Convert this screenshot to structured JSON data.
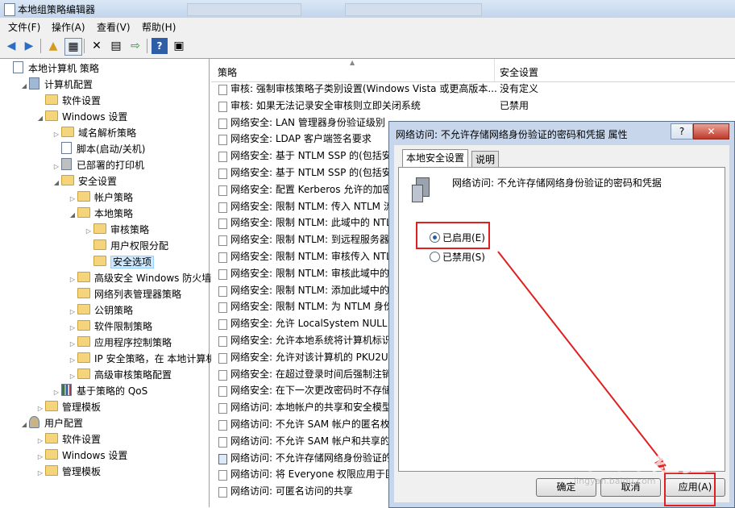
{
  "window": {
    "title": "本地组策略编辑器"
  },
  "menu": [
    "文件(F)",
    "操作(A)",
    "查看(V)",
    "帮助(H)"
  ],
  "toolbar_icons": [
    "back-icon",
    "forward-icon",
    "up-icon",
    "show-hide-tree-icon",
    "delete-icon",
    "properties-icon",
    "export-icon",
    "help-icon",
    "view-icon"
  ],
  "tree": [
    {
      "label": "本地计算机 策略",
      "level": 0,
      "icon": "doc",
      "arrow": ""
    },
    {
      "label": "计算机配置",
      "level": 1,
      "icon": "computer",
      "arrow": "◢"
    },
    {
      "label": "软件设置",
      "level": 2,
      "icon": "folder",
      "arrow": ""
    },
    {
      "label": "Windows 设置",
      "level": 2,
      "icon": "folder",
      "arrow": "◢"
    },
    {
      "label": "域名解析策略",
      "level": 3,
      "icon": "folder",
      "arrow": "▷"
    },
    {
      "label": "脚本(启动/关机)",
      "level": 3,
      "icon": "doc",
      "arrow": ""
    },
    {
      "label": "已部署的打印机",
      "level": 3,
      "icon": "printer",
      "arrow": "▷"
    },
    {
      "label": "安全设置",
      "level": 3,
      "icon": "folder",
      "arrow": "◢"
    },
    {
      "label": "帐户策略",
      "level": 4,
      "icon": "folder",
      "arrow": "▷"
    },
    {
      "label": "本地策略",
      "level": 4,
      "icon": "folder",
      "arrow": "◢"
    },
    {
      "label": "审核策略",
      "level": 5,
      "icon": "folder",
      "arrow": "▷"
    },
    {
      "label": "用户权限分配",
      "level": 5,
      "icon": "folder",
      "arrow": ""
    },
    {
      "label": "安全选项",
      "level": 5,
      "icon": "folder",
      "arrow": "",
      "selected": true
    },
    {
      "label": "高级安全 Windows 防火墙",
      "level": 4,
      "icon": "folder",
      "arrow": "▷"
    },
    {
      "label": "网络列表管理器策略",
      "level": 4,
      "icon": "folder",
      "arrow": ""
    },
    {
      "label": "公钥策略",
      "level": 4,
      "icon": "folder",
      "arrow": "▷"
    },
    {
      "label": "软件限制策略",
      "level": 4,
      "icon": "folder",
      "arrow": "▷"
    },
    {
      "label": "应用程序控制策略",
      "level": 4,
      "icon": "folder",
      "arrow": "▷"
    },
    {
      "label": "IP 安全策略，在 本地计算机",
      "level": 4,
      "icon": "folder",
      "arrow": "▷"
    },
    {
      "label": "高级审核策略配置",
      "level": 4,
      "icon": "folder",
      "arrow": "▷"
    },
    {
      "label": "基于策略的 QoS",
      "level": 3,
      "icon": "chart",
      "arrow": "▷"
    },
    {
      "label": "管理模板",
      "level": 2,
      "icon": "folder",
      "arrow": "▷"
    },
    {
      "label": "用户配置",
      "level": 1,
      "icon": "user",
      "arrow": "◢"
    },
    {
      "label": "软件设置",
      "level": 2,
      "icon": "folder",
      "arrow": "▷"
    },
    {
      "label": "Windows 设置",
      "level": 2,
      "icon": "folder",
      "arrow": "▷"
    },
    {
      "label": "管理模板",
      "level": 2,
      "icon": "folder",
      "arrow": "▷"
    }
  ],
  "list": {
    "col_policy": "策略",
    "col_setting": "安全设置",
    "rows": [
      {
        "policy": "审核: 强制审核策略子类别设置(Windows Vista 或更高版本...",
        "setting": "没有定义"
      },
      {
        "policy": "审核: 如果无法记录安全审核则立即关闭系统",
        "setting": "已禁用"
      },
      {
        "policy": "网络安全: LAN 管理器身份验证级别",
        "setting": ""
      },
      {
        "policy": "网络安全: LDAP 客户端签名要求",
        "setting": ""
      },
      {
        "policy": "网络安全: 基于 NTLM SSP 的(包括安",
        "setting": ""
      },
      {
        "policy": "网络安全: 基于 NTLM SSP 的(包括安",
        "setting": ""
      },
      {
        "policy": "网络安全: 配置 Kerberos 允许的加密",
        "setting": ""
      },
      {
        "policy": "网络安全: 限制 NTLM: 传入 NTLM 流",
        "setting": ""
      },
      {
        "policy": "网络安全: 限制 NTLM: 此域中的 NTL",
        "setting": ""
      },
      {
        "policy": "网络安全: 限制 NTLM: 到远程服务器",
        "setting": ""
      },
      {
        "policy": "网络安全: 限制 NTLM: 审核传入 NTL",
        "setting": ""
      },
      {
        "policy": "网络安全: 限制 NTLM: 审核此域中的",
        "setting": ""
      },
      {
        "policy": "网络安全: 限制 NTLM: 添加此域中的",
        "setting": ""
      },
      {
        "policy": "网络安全: 限制 NTLM: 为 NTLM 身份",
        "setting": ""
      },
      {
        "policy": "网络安全: 允许 LocalSystem NULL 会",
        "setting": ""
      },
      {
        "policy": "网络安全: 允许本地系统将计算机标识",
        "setting": ""
      },
      {
        "policy": "网络安全: 允许对该计算机的 PKU2U",
        "setting": ""
      },
      {
        "policy": "网络安全: 在超过登录时间后强制注销",
        "setting": ""
      },
      {
        "policy": "网络安全: 在下一次更改密码时不存储",
        "setting": ""
      },
      {
        "policy": "网络访问: 本地帐户的共享和安全模型",
        "setting": ""
      },
      {
        "policy": "网络访问: 不允许 SAM 帐户的匿名枚",
        "setting": ""
      },
      {
        "policy": "网络访问: 不允许 SAM 帐户和共享的",
        "setting": ""
      },
      {
        "policy": "网络访问: 不允许存储网络身份验证的",
        "setting": "",
        "selected": true
      },
      {
        "policy": "网络访问: 将 Everyone 权限应用于匿",
        "setting": ""
      },
      {
        "policy": "网络访问: 可匿名访问的共享",
        "setting": ""
      }
    ]
  },
  "dialog": {
    "title": "网络访问: 不允许存储网络身份验证的密码和凭据 属性",
    "help": "?",
    "close": "✕",
    "tab_local": "本地安全设置",
    "tab_explain": "说明",
    "policy_name": "网络访问: 不允许存储网络身份验证的密码和凭据",
    "enabled": "已启用(E)",
    "disabled": "已禁用(S)",
    "ok": "确定",
    "cancel": "取消",
    "apply": "应用(A)"
  },
  "watermark": "Baidu经验",
  "watermark_sub": "jingyan.baidu.com",
  "annotation_color": "#e02020"
}
